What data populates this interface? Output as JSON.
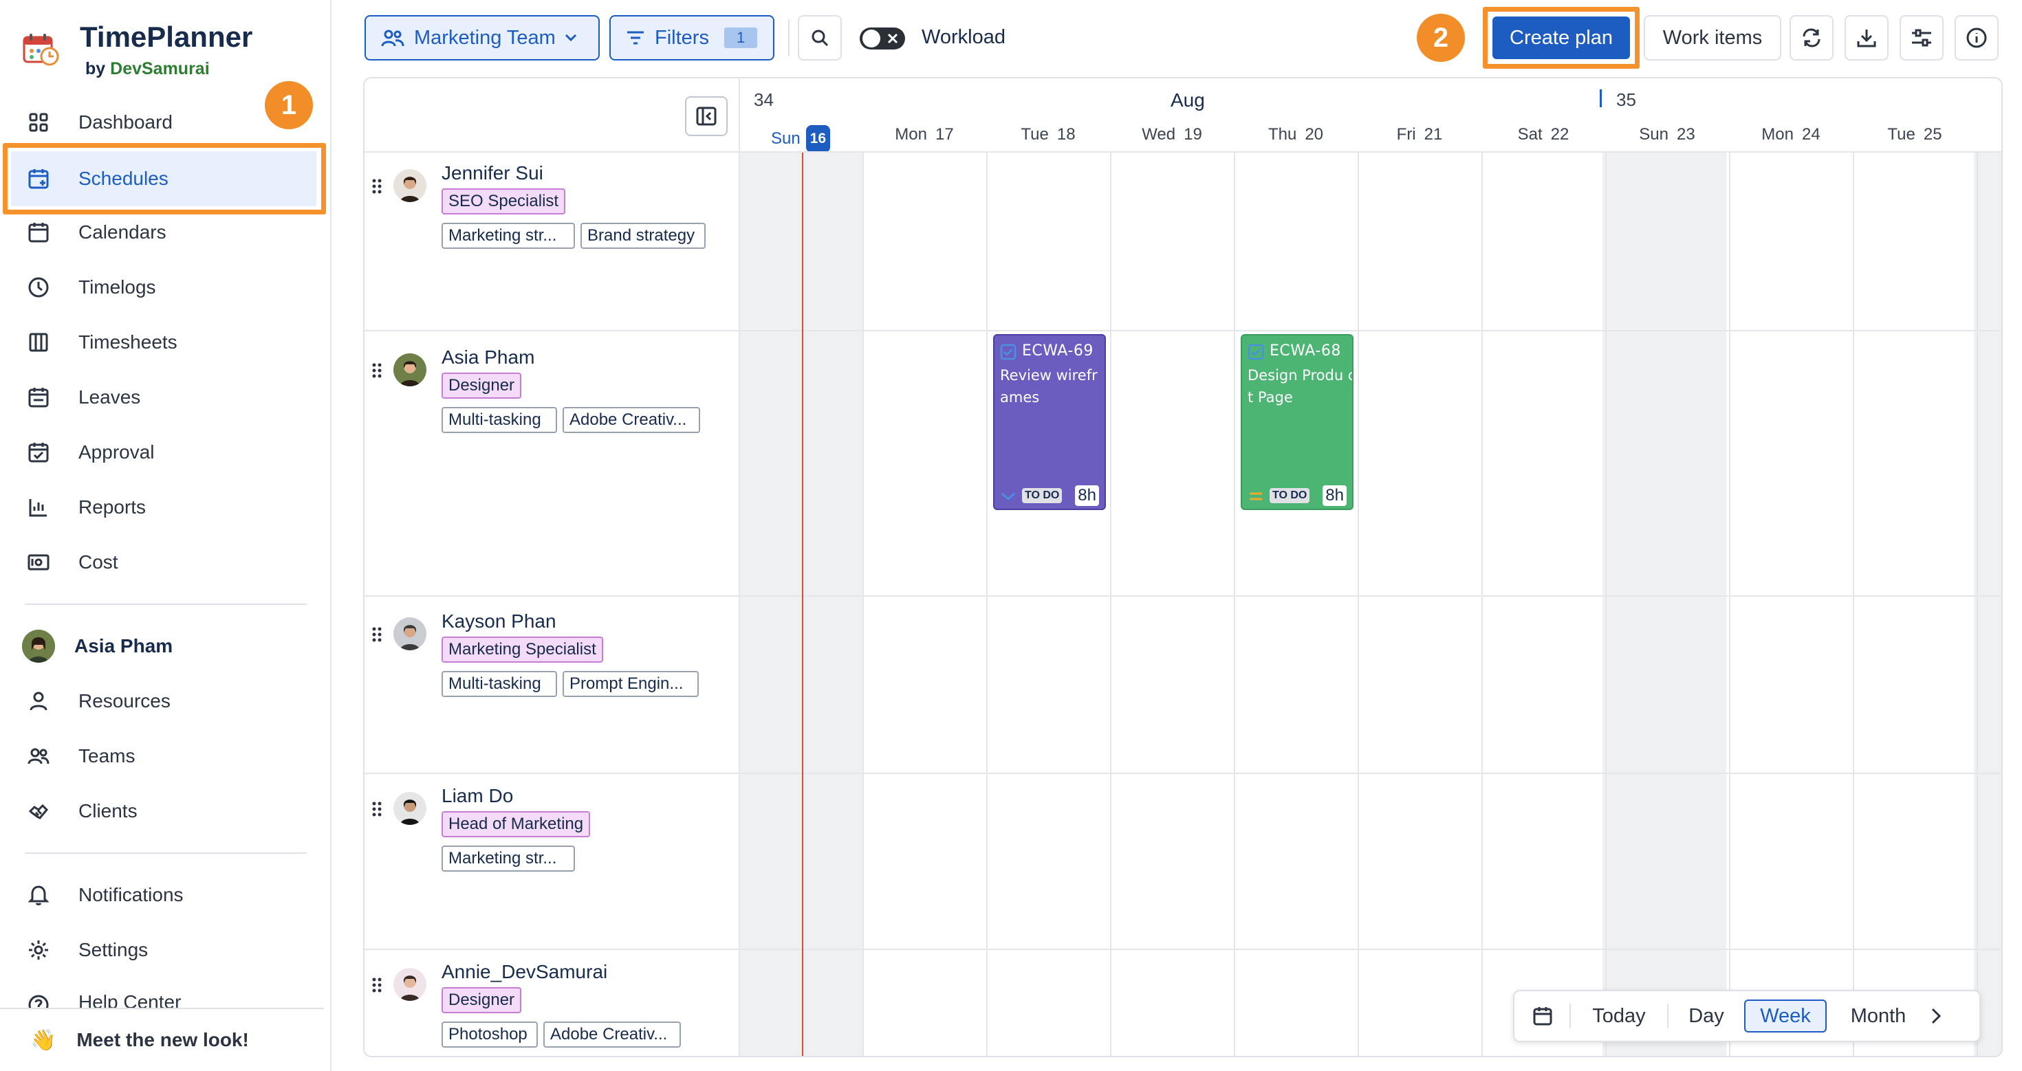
{
  "app": {
    "title": "TimePlanner",
    "by": "by",
    "brand": "DevSamurai"
  },
  "sidebar": {
    "items": [
      {
        "label": "Dashboard",
        "icon": "grid-icon"
      },
      {
        "label": "Schedules",
        "icon": "calendar-plus-icon"
      },
      {
        "label": "Calendars",
        "icon": "calendar-icon"
      },
      {
        "label": "Timelogs",
        "icon": "clock-icon"
      },
      {
        "label": "Timesheets",
        "icon": "columns-icon"
      },
      {
        "label": "Leaves",
        "icon": "calendar-leave-icon"
      },
      {
        "label": "Approval",
        "icon": "calendar-check-icon"
      },
      {
        "label": "Reports",
        "icon": "bar-chart-icon"
      },
      {
        "label": "Cost",
        "icon": "cash-icon"
      }
    ],
    "user": {
      "name": "Asia Pham"
    },
    "items2": [
      {
        "label": "Resources",
        "icon": "person-icon"
      },
      {
        "label": "Teams",
        "icon": "people-icon"
      },
      {
        "label": "Clients",
        "icon": "handshake-icon"
      }
    ],
    "items3": [
      {
        "label": "Notifications",
        "icon": "bell-icon"
      },
      {
        "label": "Settings",
        "icon": "gear-icon"
      },
      {
        "label": "Help Center",
        "icon": "help-icon"
      }
    ],
    "meet_new_look": "Meet the new look!",
    "step1": "1"
  },
  "toolbar": {
    "team_select": "Marketing Team",
    "filters_label": "Filters",
    "filters_count": "1",
    "workload_label": "Workload",
    "step2": "2",
    "create_plan": "Create plan",
    "work_items": "Work items"
  },
  "calendar": {
    "week1": "34",
    "month": "Aug",
    "week2": "35",
    "days": [
      {
        "dow": "Sun",
        "num": "16",
        "today": true
      },
      {
        "dow": "Mon",
        "num": "17"
      },
      {
        "dow": "Tue",
        "num": "18"
      },
      {
        "dow": "Wed",
        "num": "19"
      },
      {
        "dow": "Thu",
        "num": "20"
      },
      {
        "dow": "Fri",
        "num": "21"
      },
      {
        "dow": "Sat",
        "num": "22"
      },
      {
        "dow": "Sun",
        "num": "23"
      },
      {
        "dow": "Mon",
        "num": "24"
      },
      {
        "dow": "Tue",
        "num": "25"
      }
    ]
  },
  "resources": [
    {
      "name": "Jennifer Sui",
      "role": "SEO Specialist",
      "skills": [
        "Marketing str...",
        "Brand strategy"
      ]
    },
    {
      "name": "Asia Pham",
      "role": "Designer",
      "skills": [
        "Multi-tasking",
        "Adobe Creativ..."
      ]
    },
    {
      "name": "Kayson Phan",
      "role": "Marketing Specialist",
      "skills": [
        "Multi-tasking",
        "Prompt Engin..."
      ]
    },
    {
      "name": "Liam Do",
      "role": "Head of Marketing",
      "skills": [
        "Marketing str..."
      ]
    },
    {
      "name": "Annie_DevSamurai",
      "role": "Designer",
      "skills": [
        "Photoshop",
        "Adobe Creativ..."
      ]
    }
  ],
  "tasks": [
    {
      "key": "ECWA-69",
      "title": "Review wirefr ames",
      "status": "TO DO",
      "hours": "8h",
      "color": "#6b5dc0"
    },
    {
      "key": "ECWA-68",
      "title": "Design Produ ct Page",
      "status": "TO DO",
      "hours": "8h",
      "color": "#4cb574"
    }
  ],
  "viewbar": {
    "today": "Today",
    "day": "Day",
    "week": "Week",
    "month": "Month"
  },
  "colors": {
    "accent": "#1d5dc1",
    "highlight": "#f5922b",
    "today_line": "#e0453a"
  }
}
